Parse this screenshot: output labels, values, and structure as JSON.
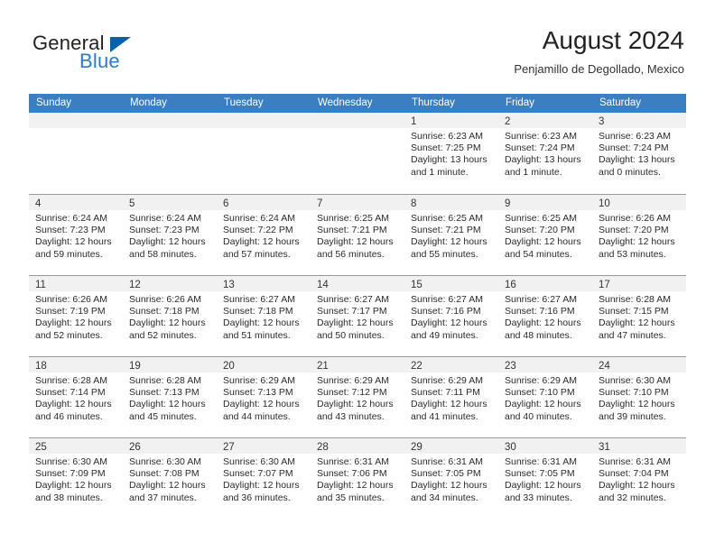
{
  "brand": {
    "name_part1": "General",
    "name_part2": "Blue"
  },
  "header": {
    "title": "August 2024",
    "location": "Penjamillo de Degollado, Mexico"
  },
  "colors": {
    "header_blue": "#3C7EC2",
    "logo_blue": "#2B7CC4",
    "triangle_blue": "#0A61AA",
    "daynum_strip": "#F1F1F1",
    "grid_line": "#9A9A9A"
  },
  "weekdays": [
    "Sunday",
    "Monday",
    "Tuesday",
    "Wednesday",
    "Thursday",
    "Friday",
    "Saturday"
  ],
  "weeks": [
    [
      {
        "day": "",
        "empty": true
      },
      {
        "day": "",
        "empty": true
      },
      {
        "day": "",
        "empty": true
      },
      {
        "day": "",
        "empty": true
      },
      {
        "day": "1",
        "sunrise": "Sunrise: 6:23 AM",
        "sunset": "Sunset: 7:25 PM",
        "daylight1": "Daylight: 13 hours",
        "daylight2": "and 1 minute."
      },
      {
        "day": "2",
        "sunrise": "Sunrise: 6:23 AM",
        "sunset": "Sunset: 7:24 PM",
        "daylight1": "Daylight: 13 hours",
        "daylight2": "and 1 minute."
      },
      {
        "day": "3",
        "sunrise": "Sunrise: 6:23 AM",
        "sunset": "Sunset: 7:24 PM",
        "daylight1": "Daylight: 13 hours",
        "daylight2": "and 0 minutes."
      }
    ],
    [
      {
        "day": "4",
        "sunrise": "Sunrise: 6:24 AM",
        "sunset": "Sunset: 7:23 PM",
        "daylight1": "Daylight: 12 hours",
        "daylight2": "and 59 minutes."
      },
      {
        "day": "5",
        "sunrise": "Sunrise: 6:24 AM",
        "sunset": "Sunset: 7:23 PM",
        "daylight1": "Daylight: 12 hours",
        "daylight2": "and 58 minutes."
      },
      {
        "day": "6",
        "sunrise": "Sunrise: 6:24 AM",
        "sunset": "Sunset: 7:22 PM",
        "daylight1": "Daylight: 12 hours",
        "daylight2": "and 57 minutes."
      },
      {
        "day": "7",
        "sunrise": "Sunrise: 6:25 AM",
        "sunset": "Sunset: 7:21 PM",
        "daylight1": "Daylight: 12 hours",
        "daylight2": "and 56 minutes."
      },
      {
        "day": "8",
        "sunrise": "Sunrise: 6:25 AM",
        "sunset": "Sunset: 7:21 PM",
        "daylight1": "Daylight: 12 hours",
        "daylight2": "and 55 minutes."
      },
      {
        "day": "9",
        "sunrise": "Sunrise: 6:25 AM",
        "sunset": "Sunset: 7:20 PM",
        "daylight1": "Daylight: 12 hours",
        "daylight2": "and 54 minutes."
      },
      {
        "day": "10",
        "sunrise": "Sunrise: 6:26 AM",
        "sunset": "Sunset: 7:20 PM",
        "daylight1": "Daylight: 12 hours",
        "daylight2": "and 53 minutes."
      }
    ],
    [
      {
        "day": "11",
        "sunrise": "Sunrise: 6:26 AM",
        "sunset": "Sunset: 7:19 PM",
        "daylight1": "Daylight: 12 hours",
        "daylight2": "and 52 minutes."
      },
      {
        "day": "12",
        "sunrise": "Sunrise: 6:26 AM",
        "sunset": "Sunset: 7:18 PM",
        "daylight1": "Daylight: 12 hours",
        "daylight2": "and 52 minutes."
      },
      {
        "day": "13",
        "sunrise": "Sunrise: 6:27 AM",
        "sunset": "Sunset: 7:18 PM",
        "daylight1": "Daylight: 12 hours",
        "daylight2": "and 51 minutes."
      },
      {
        "day": "14",
        "sunrise": "Sunrise: 6:27 AM",
        "sunset": "Sunset: 7:17 PM",
        "daylight1": "Daylight: 12 hours",
        "daylight2": "and 50 minutes."
      },
      {
        "day": "15",
        "sunrise": "Sunrise: 6:27 AM",
        "sunset": "Sunset: 7:16 PM",
        "daylight1": "Daylight: 12 hours",
        "daylight2": "and 49 minutes."
      },
      {
        "day": "16",
        "sunrise": "Sunrise: 6:27 AM",
        "sunset": "Sunset: 7:16 PM",
        "daylight1": "Daylight: 12 hours",
        "daylight2": "and 48 minutes."
      },
      {
        "day": "17",
        "sunrise": "Sunrise: 6:28 AM",
        "sunset": "Sunset: 7:15 PM",
        "daylight1": "Daylight: 12 hours",
        "daylight2": "and 47 minutes."
      }
    ],
    [
      {
        "day": "18",
        "sunrise": "Sunrise: 6:28 AM",
        "sunset": "Sunset: 7:14 PM",
        "daylight1": "Daylight: 12 hours",
        "daylight2": "and 46 minutes."
      },
      {
        "day": "19",
        "sunrise": "Sunrise: 6:28 AM",
        "sunset": "Sunset: 7:13 PM",
        "daylight1": "Daylight: 12 hours",
        "daylight2": "and 45 minutes."
      },
      {
        "day": "20",
        "sunrise": "Sunrise: 6:29 AM",
        "sunset": "Sunset: 7:13 PM",
        "daylight1": "Daylight: 12 hours",
        "daylight2": "and 44 minutes."
      },
      {
        "day": "21",
        "sunrise": "Sunrise: 6:29 AM",
        "sunset": "Sunset: 7:12 PM",
        "daylight1": "Daylight: 12 hours",
        "daylight2": "and 43 minutes."
      },
      {
        "day": "22",
        "sunrise": "Sunrise: 6:29 AM",
        "sunset": "Sunset: 7:11 PM",
        "daylight1": "Daylight: 12 hours",
        "daylight2": "and 41 minutes."
      },
      {
        "day": "23",
        "sunrise": "Sunrise: 6:29 AM",
        "sunset": "Sunset: 7:10 PM",
        "daylight1": "Daylight: 12 hours",
        "daylight2": "and 40 minutes."
      },
      {
        "day": "24",
        "sunrise": "Sunrise: 6:30 AM",
        "sunset": "Sunset: 7:10 PM",
        "daylight1": "Daylight: 12 hours",
        "daylight2": "and 39 minutes."
      }
    ],
    [
      {
        "day": "25",
        "sunrise": "Sunrise: 6:30 AM",
        "sunset": "Sunset: 7:09 PM",
        "daylight1": "Daylight: 12 hours",
        "daylight2": "and 38 minutes."
      },
      {
        "day": "26",
        "sunrise": "Sunrise: 6:30 AM",
        "sunset": "Sunset: 7:08 PM",
        "daylight1": "Daylight: 12 hours",
        "daylight2": "and 37 minutes."
      },
      {
        "day": "27",
        "sunrise": "Sunrise: 6:30 AM",
        "sunset": "Sunset: 7:07 PM",
        "daylight1": "Daylight: 12 hours",
        "daylight2": "and 36 minutes."
      },
      {
        "day": "28",
        "sunrise": "Sunrise: 6:31 AM",
        "sunset": "Sunset: 7:06 PM",
        "daylight1": "Daylight: 12 hours",
        "daylight2": "and 35 minutes."
      },
      {
        "day": "29",
        "sunrise": "Sunrise: 6:31 AM",
        "sunset": "Sunset: 7:05 PM",
        "daylight1": "Daylight: 12 hours",
        "daylight2": "and 34 minutes."
      },
      {
        "day": "30",
        "sunrise": "Sunrise: 6:31 AM",
        "sunset": "Sunset: 7:05 PM",
        "daylight1": "Daylight: 12 hours",
        "daylight2": "and 33 minutes."
      },
      {
        "day": "31",
        "sunrise": "Sunrise: 6:31 AM",
        "sunset": "Sunset: 7:04 PM",
        "daylight1": "Daylight: 12 hours",
        "daylight2": "and 32 minutes."
      }
    ]
  ]
}
